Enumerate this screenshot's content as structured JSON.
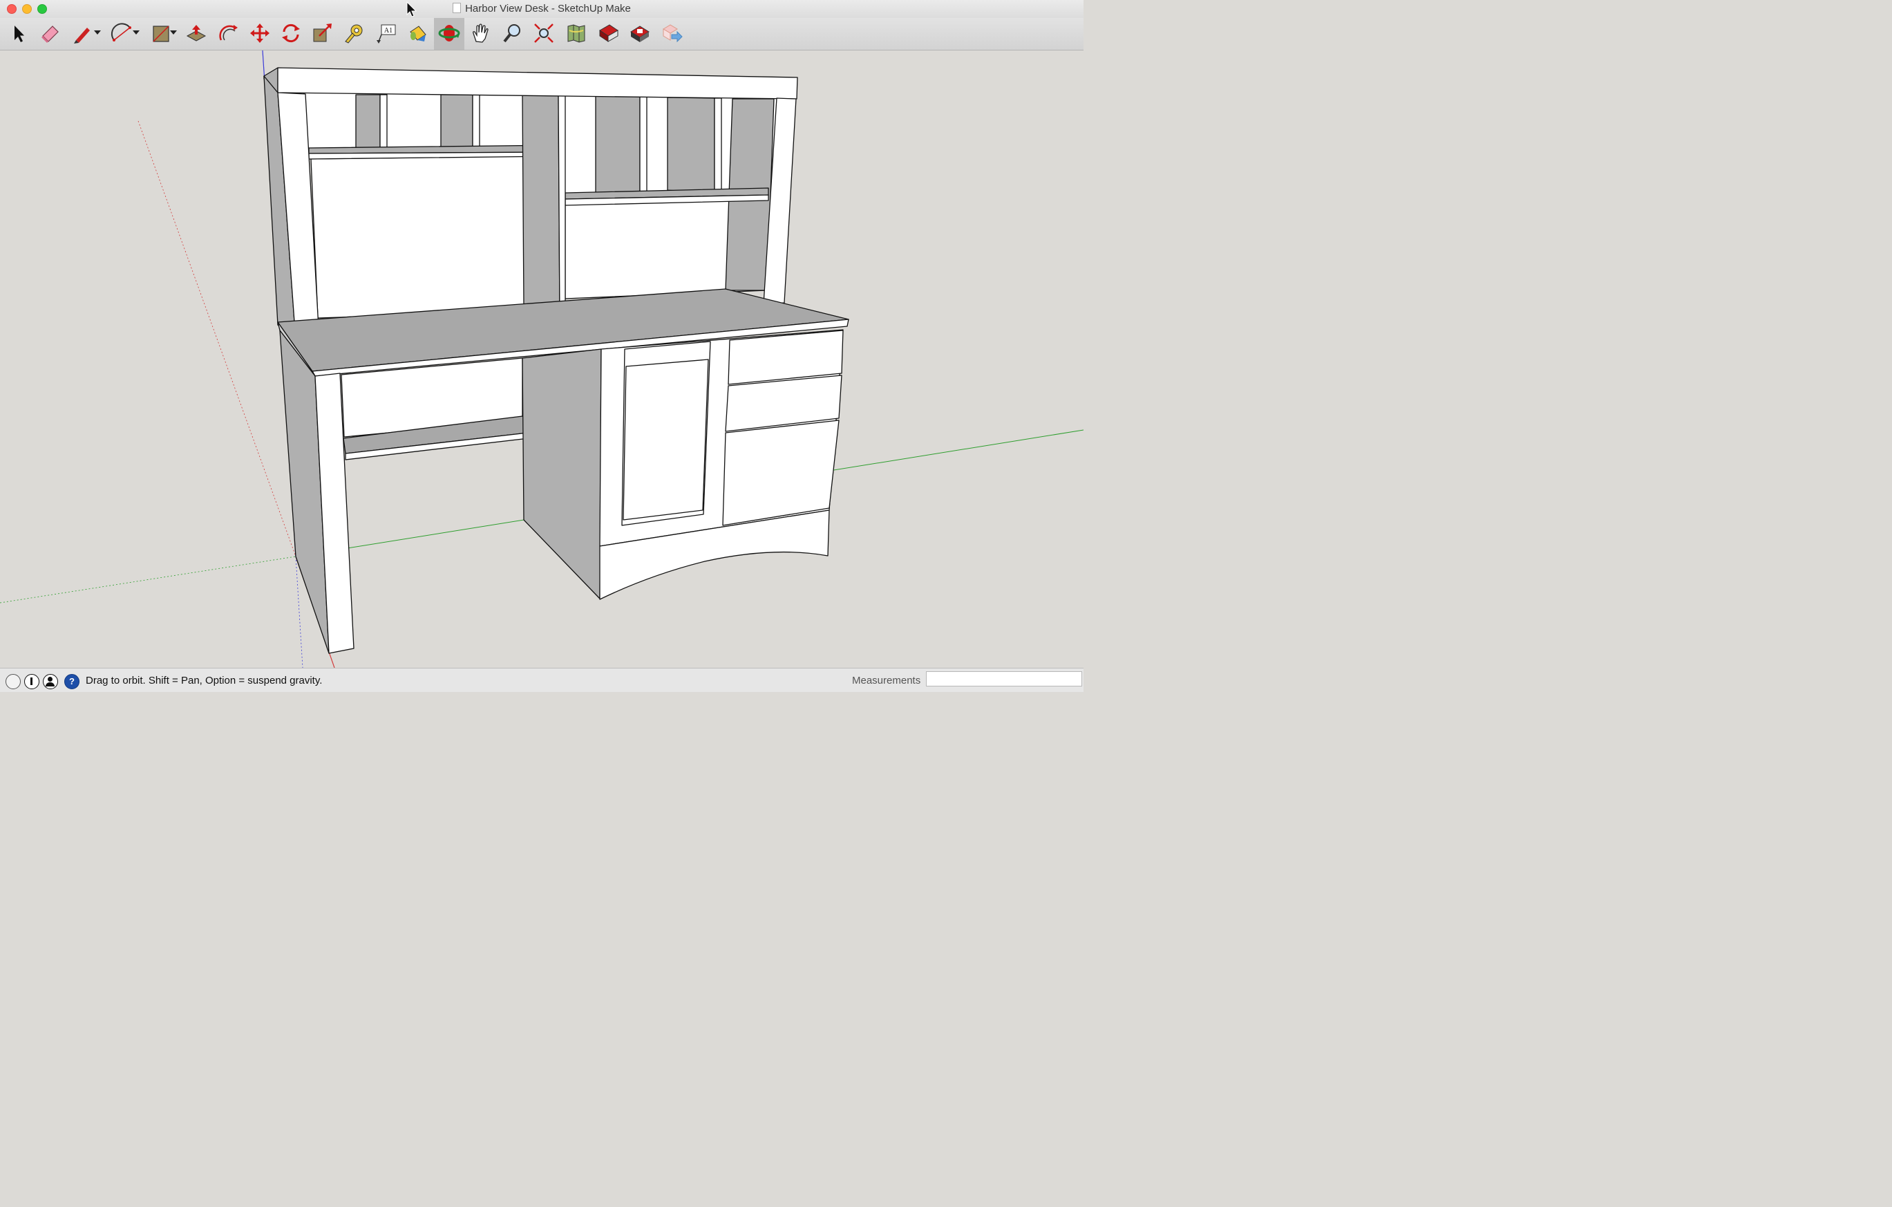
{
  "window": {
    "title": "Harbor View Desk - SketchUp Make"
  },
  "toolbar": {
    "tools": [
      {
        "name": "select-tool",
        "icon": "arrow-icon"
      },
      {
        "name": "eraser-tool",
        "icon": "eraser-icon"
      },
      {
        "name": "line-tool",
        "icon": "pencil-icon",
        "dropdown": true
      },
      {
        "name": "arc-tool",
        "icon": "arc-icon",
        "dropdown": true
      },
      {
        "name": "rectangle-tool",
        "icon": "rectangle-icon",
        "dropdown": true
      },
      {
        "name": "push-pull-tool",
        "icon": "push-pull-icon"
      },
      {
        "name": "offset-tool",
        "icon": "offset-icon"
      },
      {
        "name": "move-tool",
        "icon": "move-icon"
      },
      {
        "name": "rotate-tool",
        "icon": "rotate-icon"
      },
      {
        "name": "scale-tool",
        "icon": "scale-icon"
      },
      {
        "name": "tape-measure-tool",
        "icon": "tape-measure-icon"
      },
      {
        "name": "text-tool",
        "icon": "text-label-icon",
        "label": "A1"
      },
      {
        "name": "paint-bucket-tool",
        "icon": "paint-bucket-icon"
      },
      {
        "name": "orbit-tool",
        "icon": "orbit-icon",
        "active": true
      },
      {
        "name": "pan-tool",
        "icon": "hand-icon"
      },
      {
        "name": "zoom-tool",
        "icon": "magnifier-icon"
      },
      {
        "name": "zoom-extents-tool",
        "icon": "zoom-extents-icon"
      },
      {
        "name": "add-location-tool",
        "icon": "map-icon"
      },
      {
        "name": "3d-warehouse-tool",
        "icon": "warehouse-icon"
      },
      {
        "name": "extension-warehouse-tool",
        "icon": "extension-warehouse-icon"
      },
      {
        "name": "share-model-tool",
        "icon": "share-model-icon"
      }
    ]
  },
  "status": {
    "hint": "Drag to orbit. Shift = Pan, Option = suspend gravity.",
    "icons": [
      "geo-location-icon",
      "credits-icon",
      "user-icon",
      "help-icon"
    ]
  },
  "measurements": {
    "label": "Measurements",
    "value": ""
  },
  "colors": {
    "viewport": "#dcdad6",
    "face_front": "#ffffff",
    "face_side": "#b0b0b0",
    "face_top": "#a8a8a8",
    "edge": "#111111",
    "axis_red": "#d23c3c",
    "axis_green": "#2e9e2e",
    "axis_blue": "#3a3ad8",
    "accent_red": "#d01a1a"
  }
}
